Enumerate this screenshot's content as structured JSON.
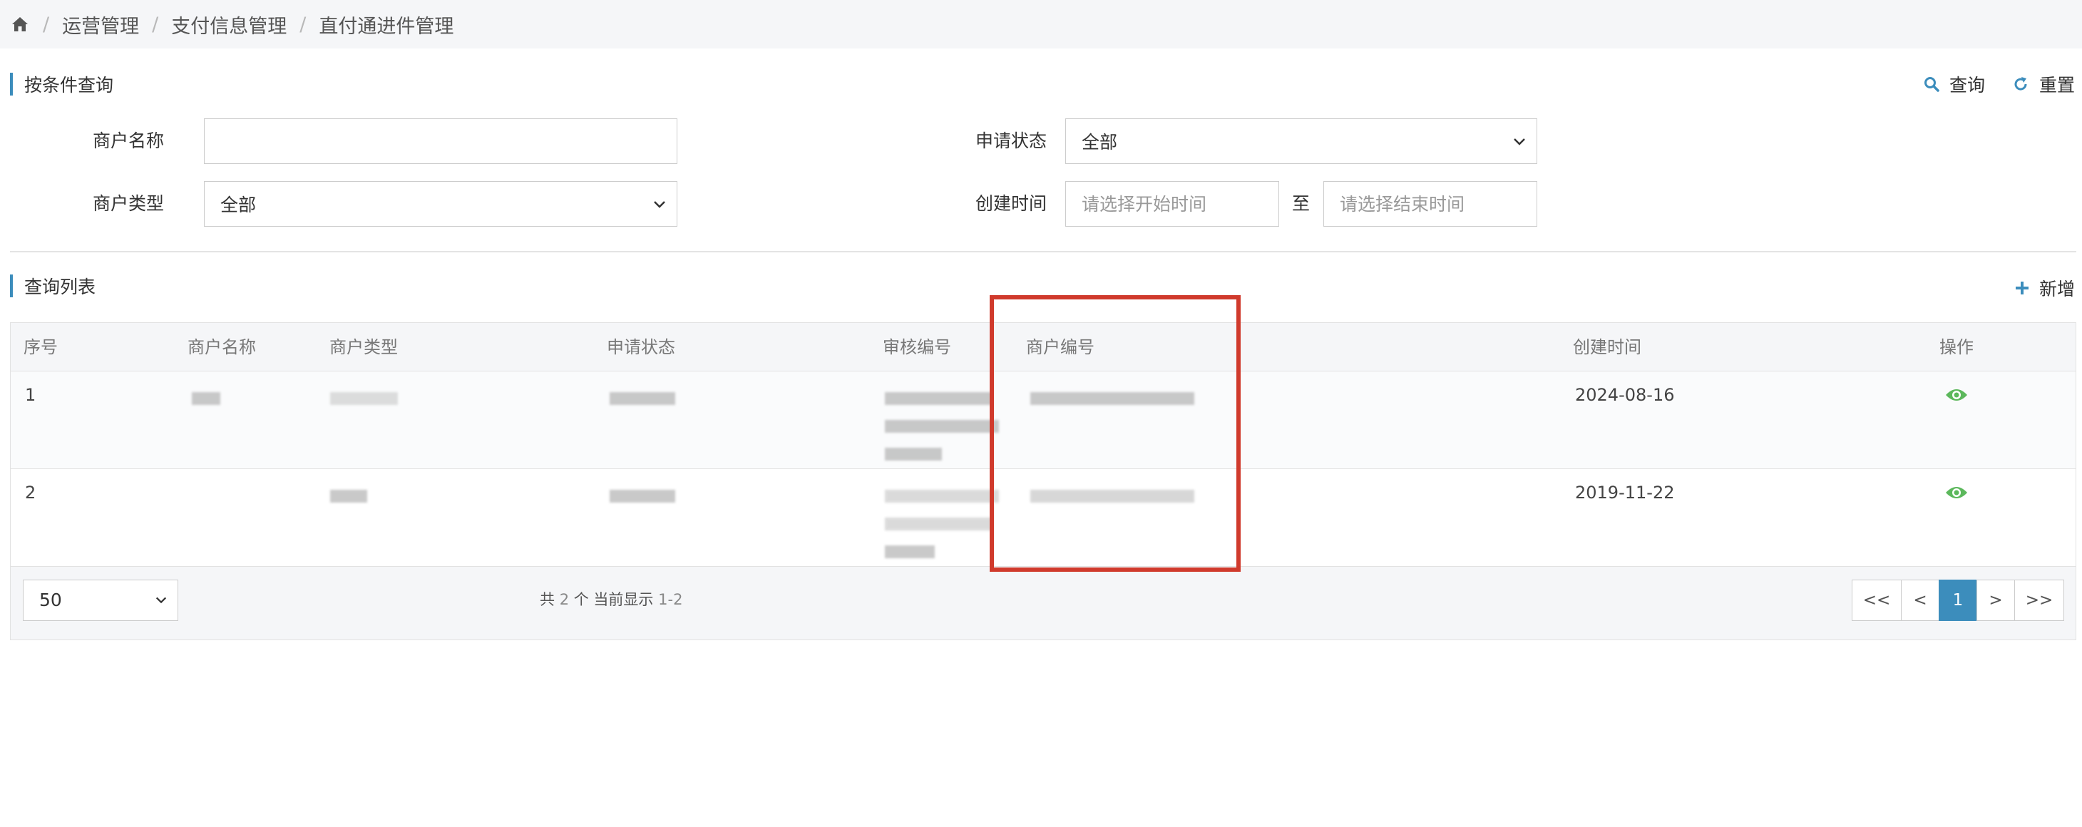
{
  "breadcrumb": {
    "items": [
      "运营管理",
      "支付信息管理",
      "直付通进件管理"
    ],
    "separator": "/"
  },
  "search_section": {
    "title": "按条件查询"
  },
  "actions": {
    "query": "查询",
    "reset": "重置",
    "add": "新增"
  },
  "form": {
    "merchant_name_label": "商户名称",
    "merchant_name_value": "",
    "apply_status_label": "申请状态",
    "apply_status_value": "全部",
    "merchant_type_label": "商户类型",
    "merchant_type_value": "全部",
    "create_time_label": "创建时间",
    "start_placeholder": "请选择开始时间",
    "to_label": "至",
    "end_placeholder": "请选择结束时间"
  },
  "list_section": {
    "title": "查询列表"
  },
  "table": {
    "columns": [
      "序号",
      "商户名称",
      "商户类型",
      "申请状态",
      "审核编号",
      "商户编号",
      "创建时间",
      "操作"
    ],
    "rows": [
      {
        "index": "1",
        "created": "2024-08-16",
        "action_icon": "eye-icon"
      },
      {
        "index": "2",
        "created": "2019-11-22",
        "action_icon": "eye-icon"
      }
    ]
  },
  "footer": {
    "page_size": "50",
    "count_prefix": "共",
    "total": "2",
    "count_mid": "个 当前显示",
    "range": "1-2",
    "pager": [
      "<<",
      "<",
      "1",
      ">",
      ">>"
    ]
  },
  "colors": {
    "accent": "#3c8dbc",
    "highlight": "#d03a2c",
    "eye": "#5cb85c"
  }
}
